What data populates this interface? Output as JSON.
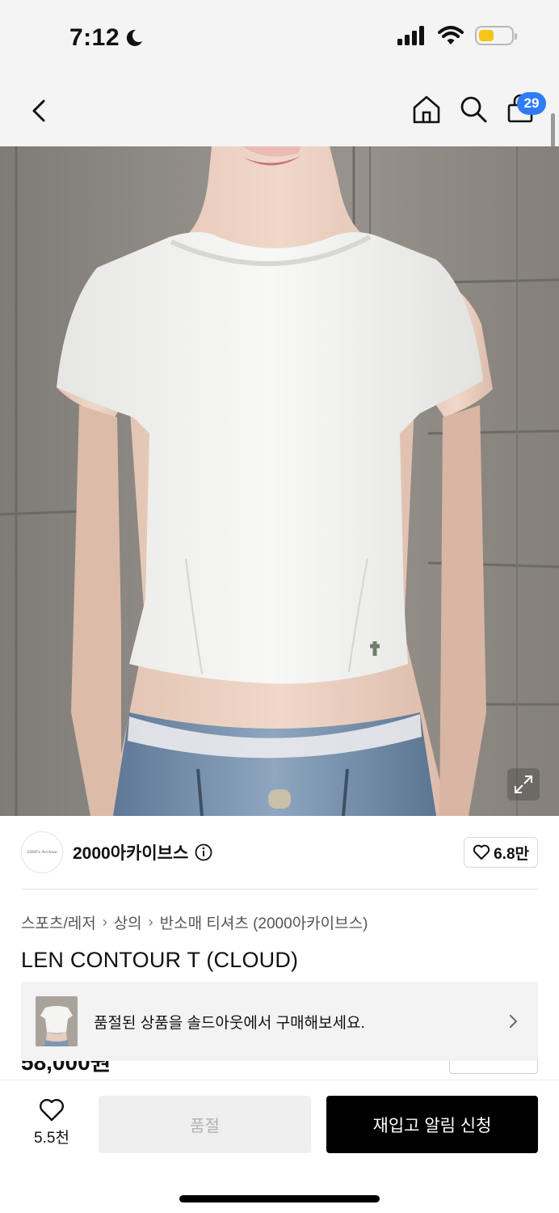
{
  "status": {
    "time": "7:12",
    "battery_level": 0.45,
    "battery_color": "#f5c518"
  },
  "nav": {
    "back_icon": "chevron-left-icon",
    "home_icon": "home-icon",
    "search_icon": "search-icon",
    "cart_icon": "shopping-bag-icon",
    "cart_count": "29",
    "badge_color": "#2f7cf6"
  },
  "product_image": {
    "expand_icon": "expand-icon"
  },
  "brand": {
    "name": "2000아카이브스",
    "logo_text": "2000's Archive",
    "likes": "6.8만"
  },
  "breadcrumb": [
    "스포츠/레저",
    "상의",
    "반소매 티셔츠 (2000아카이브스)"
  ],
  "product": {
    "title": "LEN CONTOUR T (CLOUD)",
    "price_partial": "58,000원"
  },
  "soldout_banner": {
    "text": "품절된 상품을 솔드아웃에서 구매해보세요."
  },
  "bottom": {
    "wish_count": "5.5천",
    "soldout_label": "품절",
    "restock_label": "재입고 알림 신청"
  }
}
